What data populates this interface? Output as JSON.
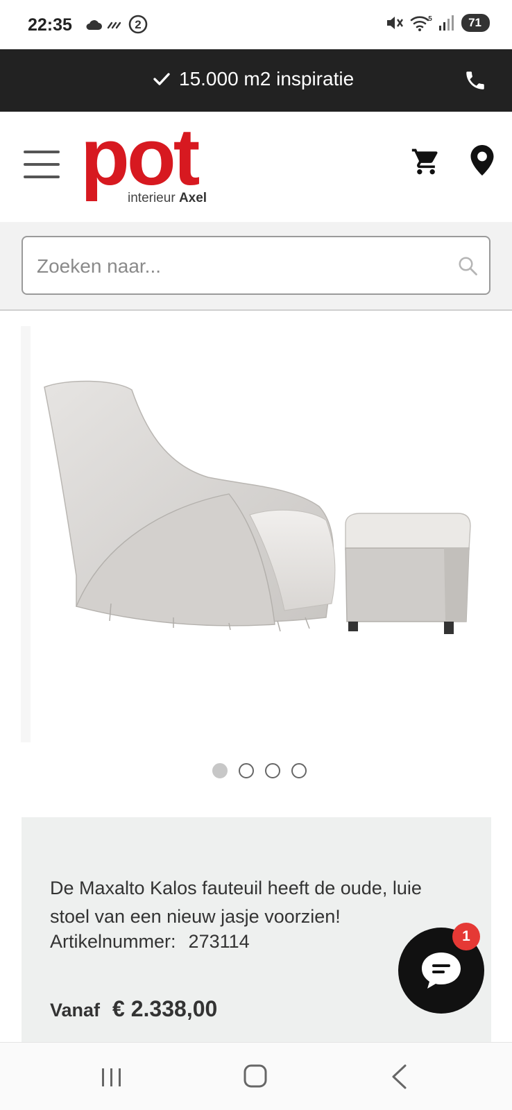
{
  "status_bar": {
    "time": "22:35",
    "left_icons": [
      "cloud-icon",
      "data-saver-icon",
      "notification-count-icon"
    ],
    "notification_count": "2",
    "right_icons": [
      "mute-icon",
      "wifi-icon",
      "signal-icon"
    ],
    "wifi_label": "5",
    "battery_level": "71"
  },
  "promo_bar": {
    "text": "15.000 m2 inspiratie",
    "check_icon": "check-icon",
    "phone_icon": "phone-icon",
    "background": "#222222"
  },
  "header": {
    "logo_word": "pot",
    "logo_sub_prefix": "interieur",
    "logo_sub_brand": "Axel",
    "logo_color": "#d71920",
    "menu_icon": "hamburger-icon",
    "cart_icon": "cart-icon",
    "location_icon": "location-pin-icon"
  },
  "search": {
    "placeholder": "Zoeken naar...",
    "value": "",
    "icon": "search-icon"
  },
  "gallery": {
    "slides": 4,
    "active_slide": 1
  },
  "product": {
    "description": "De Maxalto Kalos fauteuil heeft de oude, luie stoel van een nieuw jasje voorzien!",
    "article_label": "Artikelnummer:",
    "article_number": "273114",
    "price_label": "Vanaf",
    "price": "€ 2.338,00"
  },
  "chat": {
    "icon": "chat-icon",
    "badge": "1",
    "badge_color": "#e53935"
  },
  "nav_bar": {
    "recent_icon": "recent-apps-icon",
    "home_icon": "home-icon",
    "back_icon": "back-icon"
  }
}
